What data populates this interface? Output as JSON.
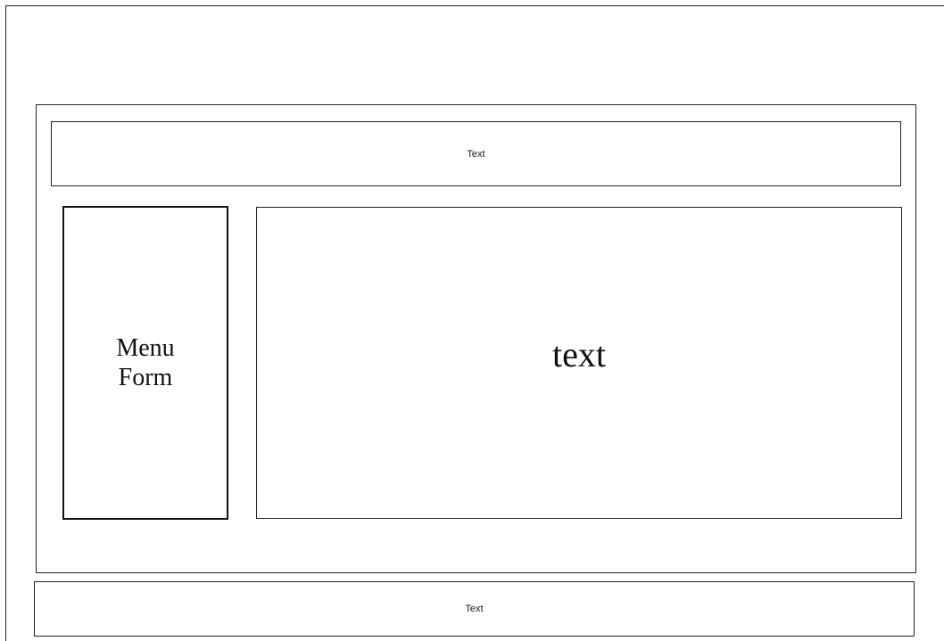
{
  "header": {
    "text": "Text"
  },
  "menu": {
    "line1": "Menu",
    "line2": "Form"
  },
  "main": {
    "text": "text"
  },
  "footer": {
    "text": "Text"
  }
}
